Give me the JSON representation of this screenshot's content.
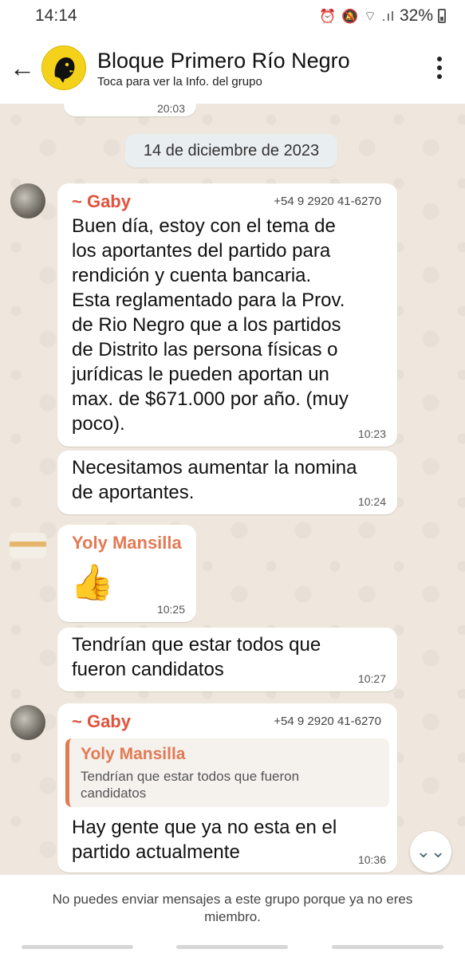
{
  "status": {
    "time": "14:14",
    "icons": "⏰ 🔕 ⌔ .ıl",
    "battery": "32%"
  },
  "header": {
    "back_icon": "←",
    "title": "Bloque Primero Río Negro",
    "subtitle": "Toca para ver la Info. del grupo"
  },
  "chat": {
    "partial_time": "20:03",
    "date": "14 de diciembre de 2023",
    "messages": [
      {
        "sender": "~ Gaby",
        "phone": "+54 9 2920 41-6270",
        "lines": [
          "Buen día, estoy con el tema de",
          "los aportantes del partido para",
          "rendición y cuenta bancaria.",
          "Esta reglamentado para la Prov.",
          "de Rio Negro que a los partidos",
          "de Distrito las persona físicas o",
          "jurídicas le pueden aportan un",
          "max. de $671.000 por año. (muy",
          "poco)."
        ],
        "time": "10:23"
      },
      {
        "lines": [
          "Necesitamos aumentar la nomina",
          "de aportantes."
        ],
        "time": "10:24"
      },
      {
        "sender": "Yoly Mansilla",
        "emoji": "👍",
        "time": "10:25"
      },
      {
        "lines": [
          "Tendrían que estar todos que",
          "fueron candidatos"
        ],
        "time": "10:27"
      },
      {
        "sender": "~ Gaby",
        "phone": "+54 9 2920 41-6270",
        "reply": {
          "name": "Yoly Mansilla",
          "lines": [
            "Tendrían que estar todos que fueron",
            "candidatos"
          ]
        },
        "lines": [
          "Hay gente que ya no esta en el",
          "partido actualmente"
        ],
        "time": "10:36"
      }
    ],
    "scroll_icon": "⌄⌄"
  },
  "footer": {
    "notice": "No puedes enviar mensajes a este grupo porque ya no eres miembro."
  },
  "colors": {
    "gaby": "#e0523c",
    "yoly": "#e27a54",
    "bubble": "#ffffff",
    "chat_bg": "#efe7dd"
  }
}
